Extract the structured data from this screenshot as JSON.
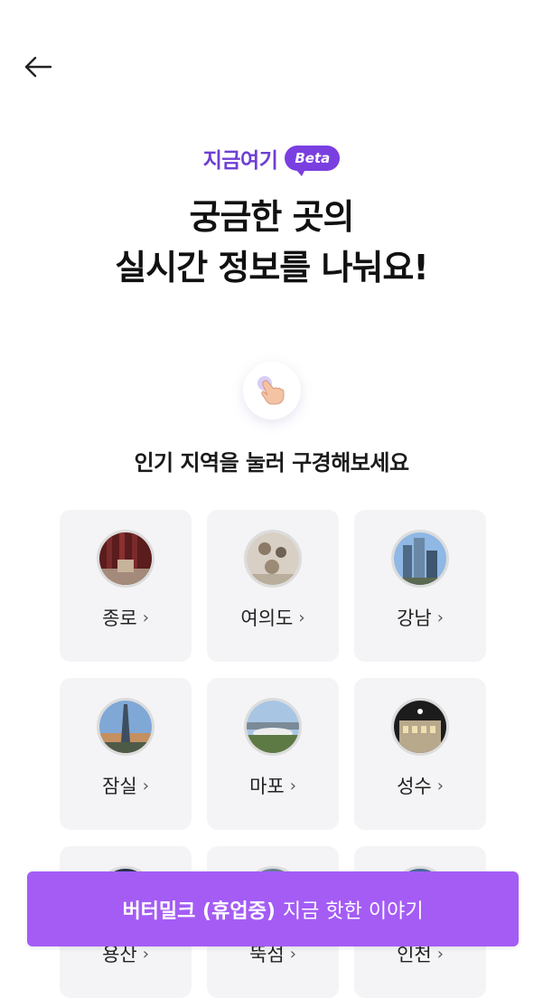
{
  "header": {
    "back_icon": "arrow-left-icon"
  },
  "hero": {
    "brand": "지금여기",
    "badge": "Beta",
    "headline_line1": "궁금한 곳의",
    "headline_line2": "실시간 정보를 나눠요!",
    "hand_icon": "pointing-hand-icon",
    "subtitle": "인기 지역을 눌러 구경해보세요"
  },
  "regions": [
    {
      "label": "종로"
    },
    {
      "label": "여의도"
    },
    {
      "label": "강남"
    },
    {
      "label": "잠실"
    },
    {
      "label": "마포"
    },
    {
      "label": "성수"
    },
    {
      "label": "용산"
    },
    {
      "label": "뚝섬"
    },
    {
      "label": "인천"
    }
  ],
  "chevron": "›",
  "cta": {
    "bold": "버터밀크 (휴업중)",
    "rest": "지금 핫한 이야기"
  },
  "colors": {
    "brand": "#6d3fd6",
    "cta": "#a45cf5",
    "card_bg": "#f4f4f6"
  }
}
